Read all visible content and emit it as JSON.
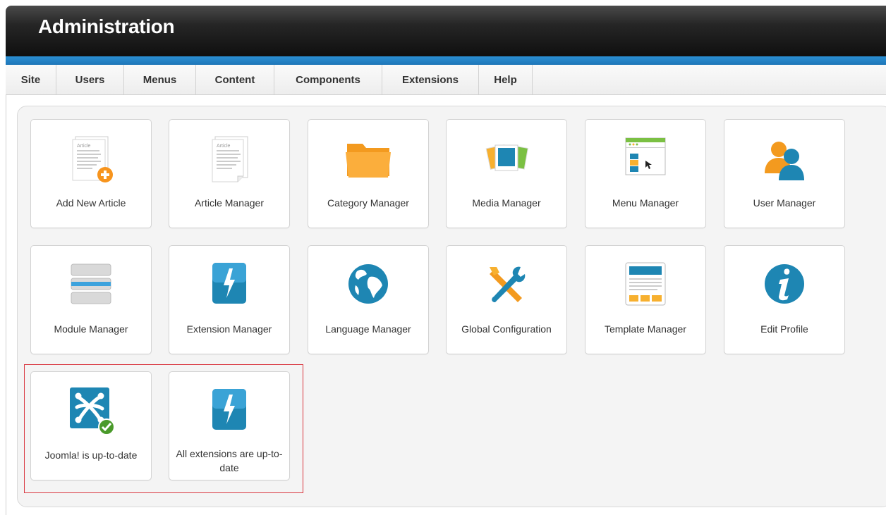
{
  "header": {
    "title": "Administration"
  },
  "menu": [
    "Site",
    "Users",
    "Menus",
    "Content",
    "Components",
    "Extensions",
    "Help"
  ],
  "tiles": [
    {
      "label": "Add New Article",
      "icon": "add-article-icon"
    },
    {
      "label": "Article Manager",
      "icon": "article-icon"
    },
    {
      "label": "Category Manager",
      "icon": "folder-icon"
    },
    {
      "label": "Media Manager",
      "icon": "media-icon"
    },
    {
      "label": "Menu Manager",
      "icon": "menu-window-icon"
    },
    {
      "label": "User Manager",
      "icon": "users-icon"
    },
    {
      "label": "Module Manager",
      "icon": "module-stack-icon"
    },
    {
      "label": "Extension Manager",
      "icon": "lightning-icon"
    },
    {
      "label": "Language Manager",
      "icon": "globe-icon"
    },
    {
      "label": "Global Configuration",
      "icon": "tools-icon"
    },
    {
      "label": "Template Manager",
      "icon": "template-icon"
    },
    {
      "label": "Edit Profile",
      "icon": "info-icon"
    },
    {
      "label": "Joomla! is up-to-date",
      "icon": "joomla-check-icon"
    },
    {
      "label": "All extensions are up-to-date",
      "icon": "lightning-icon"
    }
  ],
  "icon_text": {
    "article_heading": "Article"
  },
  "colors": {
    "header_dark": "#1a1a1a",
    "accent_blue": "#1f76b8",
    "highlight_red": "#d9343d",
    "orange": "#f7941d",
    "teal": "#1e86b3"
  }
}
